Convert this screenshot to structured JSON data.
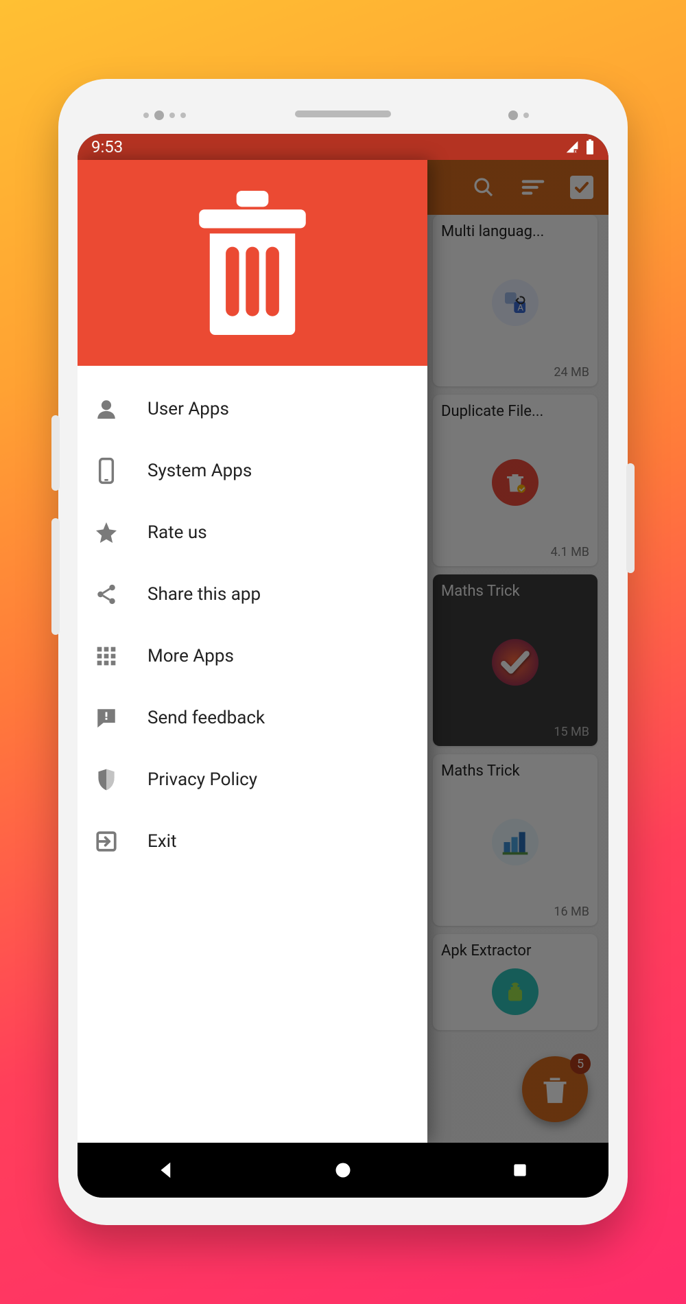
{
  "statusbar": {
    "time": "9:53"
  },
  "drawer": {
    "items": [
      {
        "icon": "person-icon",
        "label": "User Apps"
      },
      {
        "icon": "phone-icon",
        "label": "System Apps"
      },
      {
        "icon": "star-icon",
        "label": "Rate us"
      },
      {
        "icon": "share-icon",
        "label": "Share this app"
      },
      {
        "icon": "grid-icon",
        "label": "More Apps"
      },
      {
        "icon": "feedback-icon",
        "label": "Send feedback"
      },
      {
        "icon": "shield-icon",
        "label": "Privacy Policy"
      },
      {
        "icon": "exit-icon",
        "label": "Exit"
      }
    ]
  },
  "appbar": {
    "search_icon": "search-icon",
    "sort_icon": "sort-icon",
    "select_all_icon": "checkmark-icon"
  },
  "apps": [
    {
      "name": "Multi languag...",
      "size": "24 MB",
      "selected": false,
      "iconBg": "#e8eefc"
    },
    {
      "name": "Duplicate File...",
      "size": "4.1 MB",
      "selected": false,
      "iconBg": "#ec4a3b"
    },
    {
      "name": "Maths Trick",
      "size": "15 MB",
      "selected": true,
      "iconBg": "#2a2a2a"
    },
    {
      "name": "Maths Trick",
      "size": "16 MB",
      "selected": false,
      "iconBg": "#e8f4fb"
    },
    {
      "name": "Apk Extractor",
      "size": "",
      "selected": false,
      "iconBg": "#2ec0b8"
    }
  ],
  "fab": {
    "badge": "5"
  },
  "colors": {
    "accent": "#eb4a33",
    "appbar": "#d46a1e",
    "statusbar": "#b43322"
  }
}
